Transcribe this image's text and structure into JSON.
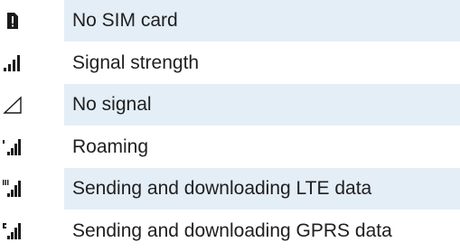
{
  "rows": [
    {
      "icon": "no-sim-icon",
      "label": "No SIM card",
      "shaded": true
    },
    {
      "icon": "signal-strength-icon",
      "label": "Signal strength",
      "shaded": false
    },
    {
      "icon": "no-signal-icon",
      "label": "No signal",
      "shaded": true
    },
    {
      "icon": "roaming-icon",
      "label": "Roaming",
      "shaded": false
    },
    {
      "icon": "lte-data-icon",
      "label": "Sending and downloading LTE data",
      "shaded": true
    },
    {
      "icon": "gprs-data-icon",
      "label": "Sending and downloading GPRS data",
      "shaded": false
    }
  ],
  "colors": {
    "shade": "#e4eef7",
    "icon": "#1a1a1a",
    "text": "#202020"
  }
}
